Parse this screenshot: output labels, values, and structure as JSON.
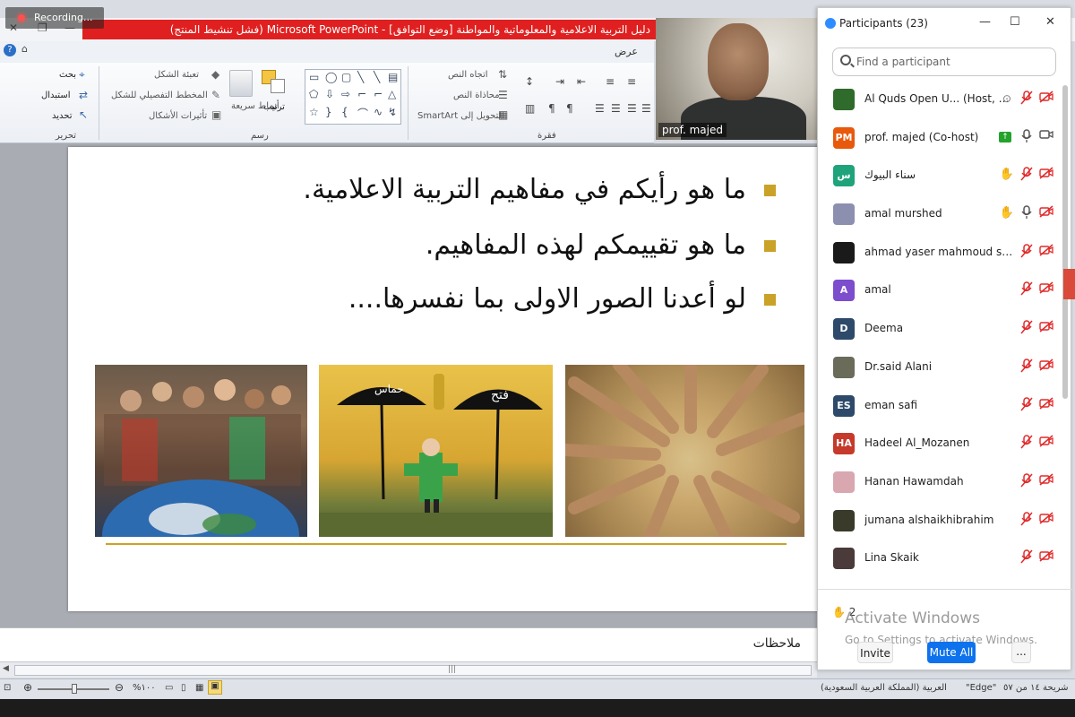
{
  "recording": {
    "label": "Recording..."
  },
  "ppt": {
    "title": "دليل التربية الاعلامية والمعلوماتية والمواطنة [وضع التوافق] - Microsoft PowerPoint (فشل تنشيط المنتج)",
    "tab_view": "عرض",
    "ribbon": {
      "editing": {
        "find": "بحث",
        "replace": "استبدال",
        "select": "تحديد",
        "group": "تحرير"
      },
      "drawing": {
        "shape_fill": "تعبئة الشكل",
        "shape_outline": "المخطط التفصيلي للشكل",
        "shape_effects": "تأثيرات الأشكال",
        "quick_styles": "أنماط سريعة",
        "arrange": "ترتيب",
        "group": "رسم"
      },
      "paragraph": {
        "text_direction": "اتجاه النص",
        "align_text": "محاذاة النص",
        "convert_smartart": "التحويل إلى SmartArt",
        "group": "فقرة"
      }
    },
    "slide": {
      "bullets": [
        "ما هو رأيكم في مفاهيم التربية الاعلامية.",
        "ما هو  تقييمكم لهذه المفاهيم.",
        "لو أعدنا الصور الاولى بما نفسرها...."
      ],
      "cartoon_labels": {
        "left": "حماس",
        "right": "فتح"
      }
    },
    "notes_label": "ملاحظات",
    "status": {
      "slide_of": "شريحة ١٤ من ٥٧",
      "theme": "\"Edge\"",
      "language": "العربية (المملكة العربية السعودية)",
      "zoom": "%١٠٠"
    }
  },
  "video": {
    "name": "prof. majed"
  },
  "participants": {
    "title": "Participants (23)",
    "search_placeholder": "Find a participant",
    "list": [
      {
        "name": "Al Quds Open U... (Host, me)",
        "avatar_text": "",
        "avatar_color": "#2f6b2a",
        "hand": false,
        "mic": "muted",
        "cam": "off",
        "extra": "record"
      },
      {
        "name": "prof. majed (Co-host)",
        "avatar_text": "PM",
        "avatar_color": "#e8590c",
        "hand": false,
        "mic": "on",
        "cam": "on",
        "extra": "share"
      },
      {
        "name": "سناء البيوك",
        "avatar_text": "س",
        "avatar_color": "#1fa37a",
        "hand": true,
        "mic": "muted",
        "cam": "off",
        "extra": ""
      },
      {
        "name": "amal murshed",
        "avatar_text": "",
        "avatar_color": "#8d8fb0",
        "hand": true,
        "mic": "on",
        "cam": "off",
        "extra": ""
      },
      {
        "name": "ahmad yaser mahmoud salag...",
        "avatar_text": "",
        "avatar_color": "#1a1a1a",
        "hand": false,
        "mic": "muted",
        "cam": "off",
        "extra": ""
      },
      {
        "name": "amal",
        "avatar_text": "A",
        "avatar_color": "#7c4dcc",
        "hand": false,
        "mic": "muted",
        "cam": "off",
        "extra": ""
      },
      {
        "name": "Deema",
        "avatar_text": "D",
        "avatar_color": "#2e4a6b",
        "hand": false,
        "mic": "muted",
        "cam": "off",
        "extra": ""
      },
      {
        "name": "Dr.said Alani",
        "avatar_text": "",
        "avatar_color": "#6b6b5a",
        "hand": false,
        "mic": "muted",
        "cam": "off",
        "extra": ""
      },
      {
        "name": "eman safi",
        "avatar_text": "ES",
        "avatar_color": "#2e4a6b",
        "hand": false,
        "mic": "muted",
        "cam": "off",
        "extra": ""
      },
      {
        "name": "Hadeel Al_Mozanen",
        "avatar_text": "HA",
        "avatar_color": "#c63a2b",
        "hand": false,
        "mic": "muted",
        "cam": "off",
        "extra": ""
      },
      {
        "name": "Hanan Hawamdah",
        "avatar_text": "",
        "avatar_color": "#d9a7b0",
        "hand": false,
        "mic": "muted",
        "cam": "off",
        "extra": ""
      },
      {
        "name": "jumana alshaikhibrahim",
        "avatar_text": "",
        "avatar_color": "#3a3a2a",
        "hand": false,
        "mic": "muted",
        "cam": "off",
        "extra": ""
      },
      {
        "name": "Lina Skaik",
        "avatar_text": "",
        "avatar_color": "#4a3a3a",
        "hand": false,
        "mic": "muted",
        "cam": "off",
        "extra": ""
      },
      {
        "name": "",
        "avatar_text": "",
        "avatar_color": "#c63a2b",
        "hand": false,
        "mic": "muted",
        "cam": "off",
        "extra": ""
      }
    ],
    "raised_count": "2",
    "activate_title": "Activate Windows",
    "activate_sub": "Go to Settings to activate Windows.",
    "invite": "Invite",
    "mute_all": "Mute All",
    "more": "..."
  }
}
